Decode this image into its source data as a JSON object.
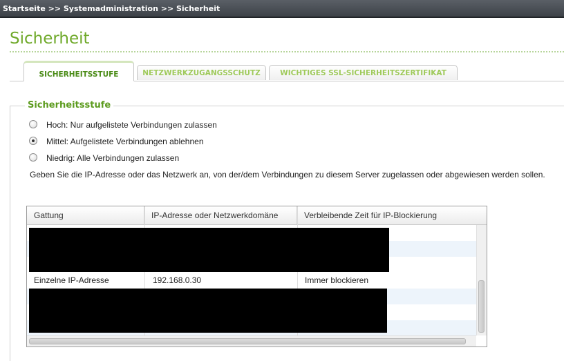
{
  "breadcrumb": "Startseite >> Systemadministration >> Sicherheit",
  "page_title": "Sicherheit",
  "tabs": [
    {
      "label": "SICHERHEITSSTUFE",
      "active": true
    },
    {
      "label": "NETZWERKZUGANGSSCHUTZ",
      "active": false
    },
    {
      "label": "WICHTIGES SSL-SICHERHEITSZERTIFIKAT",
      "active": false
    }
  ],
  "section_title": "Sicherheitsstufe",
  "options": [
    {
      "label": "Hoch: Nur aufgelistete Verbindungen zulassen",
      "checked": false
    },
    {
      "label": "Mittel: Aufgelistete Verbindungen ablehnen",
      "checked": true
    },
    {
      "label": "Niedrig: Alle Verbindungen zulassen",
      "checked": false
    }
  ],
  "description": "Geben Sie die IP-Adresse oder das Netzwerk an, von der/dem Verbindungen zu diesem Server zugelassen oder abgewiesen werden sollen.",
  "table": {
    "columns": [
      "Gattung",
      "IP-Adresse oder Netzwerkdomäne",
      "Verbleibende Zeit für IP-Blockierung"
    ],
    "visible_row": [
      "Einzelne IP-Adresse",
      "192.168.0.30",
      "Immer blockieren"
    ]
  },
  "colors": {
    "accent": "#6fa92a",
    "tab_text": "#9fca5b",
    "row_alt": "#edf4fb"
  }
}
